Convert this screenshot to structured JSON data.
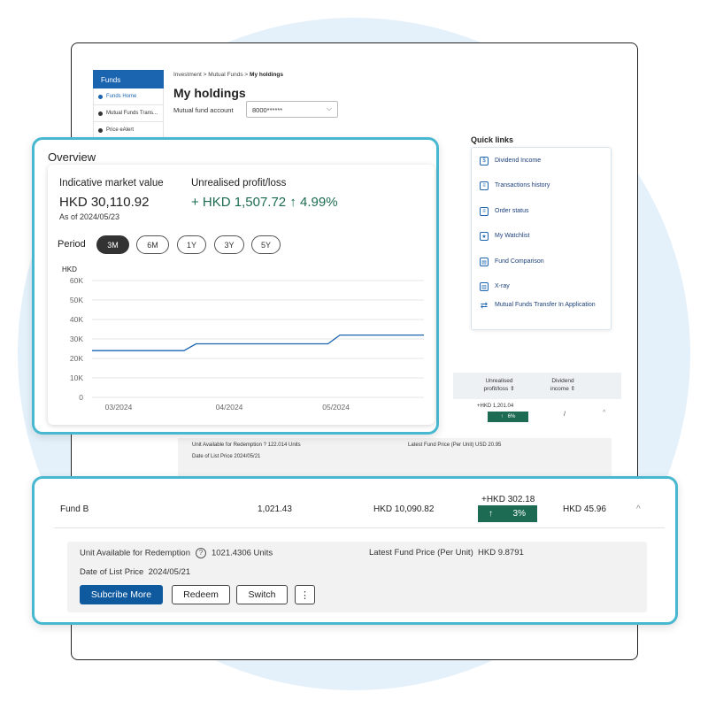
{
  "sidebar": {
    "title": "Funds",
    "items": [
      {
        "label": "Funds Home"
      },
      {
        "label": "Mutual Funds Trans..."
      },
      {
        "label": "Price eAlert"
      }
    ]
  },
  "breadcrumb": {
    "level1": "Investment",
    "level2": "Mutual Funds",
    "current": "My holdings"
  },
  "page": {
    "title": "My holdings",
    "account_label": "Mutual fund account",
    "account_value": "8000******"
  },
  "quick_links": {
    "title": "Quick links",
    "items": [
      {
        "label": "Dividend Income",
        "icon": "coins-icon"
      },
      {
        "label": "Transactions history",
        "icon": "document-list-icon"
      },
      {
        "label": "Order status",
        "icon": "clipboard-icon"
      },
      {
        "label": "My Watchlist",
        "icon": "star-list-icon"
      },
      {
        "label": "Fund Comparison",
        "icon": "compare-icon"
      },
      {
        "label": "X-ray",
        "icon": "xray-chart-icon"
      },
      {
        "label": "Mutual Funds Transfer In Application",
        "icon": "transfer-arrows-icon"
      }
    ]
  },
  "holdings_table": {
    "headers": {
      "unrealised": "Unrealised profit/loss",
      "dividend": "Dividend income"
    },
    "row_a": {
      "gain": "+HKD 1,201.04",
      "pct": "6%",
      "dividend": "/"
    },
    "detail_a": {
      "units_label": "Unit Available for Redemption",
      "units": "122.014 Units",
      "date_label": "Date of List Price",
      "date": "2024/05/21",
      "price_label": "Latest Fund Price (Per Unit)",
      "price": "USD 20.95"
    }
  },
  "overview": {
    "title": "Overview",
    "market_value_label": "Indicative market value",
    "market_value": "HKD 30,110.92",
    "as_of": "As of 2024/05/23",
    "profit_label": "Unrealised profit/loss",
    "profit_value": "+ HKD 1,507.72",
    "profit_arrow": "↑",
    "profit_pct": "4.99%",
    "period_label": "Period",
    "periods": [
      "3M",
      "6M",
      "1Y",
      "3Y",
      "5Y"
    ],
    "active_period": "3M"
  },
  "fund_b": {
    "name": "Fund B",
    "units": "1,021.43",
    "market_value": "HKD 10,090.82",
    "gain": "+HKD 302.18",
    "gain_arrow": "↑",
    "gain_pct": "3%",
    "dividend": "HKD 45.96",
    "caret": "^",
    "units_label": "Unit Available for Redemption",
    "units_available": "1021.4306 Units",
    "price_label": "Latest Fund Price (Per Unit)",
    "price": "HKD 9.8791",
    "date_label": "Date of List Price",
    "date": "2024/05/21",
    "buttons": {
      "subscribe": "Subcribe More",
      "redeem": "Redeem",
      "switch": "Switch",
      "more": "⋮"
    }
  },
  "colors": {
    "brand_blue": "#0f5a9f",
    "highlight_border": "#48b8d0",
    "gain_green": "#1c6b52",
    "line": "#1b64b0"
  },
  "chart_data": {
    "type": "line",
    "ylabel": "HKD",
    "y_ticks": [
      "0",
      "10K",
      "20K",
      "30K",
      "40K",
      "50K",
      "60K"
    ],
    "x_tick_labels": [
      "03/2024",
      "04/2024",
      "05/2024"
    ],
    "ylim": [
      0,
      60000
    ],
    "grid": true,
    "series": [
      {
        "points": [
          {
            "x": "2024-03-01",
            "y": 24000
          },
          {
            "x": "2024-03-24",
            "y": 24000
          },
          {
            "x": "2024-03-27",
            "y": 27500
          },
          {
            "x": "2024-04-29",
            "y": 27500
          },
          {
            "x": "2024-05-02",
            "y": 32000
          },
          {
            "x": "2024-05-23",
            "y": 32000
          }
        ]
      }
    ]
  }
}
